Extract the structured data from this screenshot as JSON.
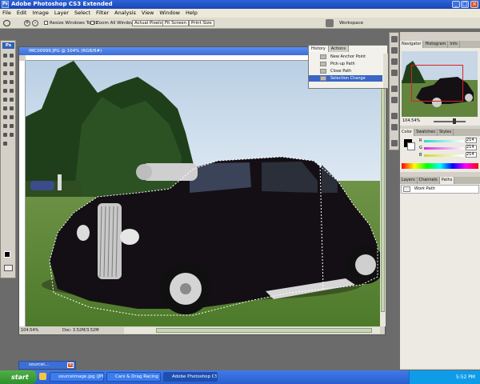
{
  "app": {
    "title": "Adobe Photoshop CS3 Extended",
    "icon_label": "Ps"
  },
  "menu": [
    "File",
    "Edit",
    "Image",
    "Layer",
    "Select",
    "Filter",
    "Analysis",
    "View",
    "Window",
    "Help"
  ],
  "options_bar": {
    "resize_windows_label": "Resize Windows To Fit",
    "zoom_all_label": "Zoom All Windows",
    "actual_pixels": "Actual Pixels",
    "fit_screen": "Fit Screen",
    "print_size": "Print Size",
    "workspace": "Workspace"
  },
  "toolbox": {
    "badge": "Ps"
  },
  "document": {
    "title": "IMC00999.JPG @ 104% (RGB/8#)",
    "zoom": "104.54%",
    "doc_info": "Doc: 3.52M/3.52M"
  },
  "history_panel": {
    "tabs": [
      "History",
      "Actions"
    ],
    "items": [
      "New Anchor Point",
      "Pick-up Path",
      "Close Path",
      "Selection Change"
    ],
    "selected_index": 3
  },
  "navigator_panel": {
    "tabs": [
      "Navigator",
      "Histogram",
      "Info"
    ],
    "zoom": "104.54%"
  },
  "color_panel": {
    "tabs": [
      "Color",
      "Swatches",
      "Styles"
    ],
    "channels": [
      {
        "label": "R",
        "value": "214"
      },
      {
        "label": "G",
        "value": "214"
      },
      {
        "label": "B",
        "value": "214"
      }
    ]
  },
  "paths_panel": {
    "tabs": [
      "Layers",
      "Channels",
      "Paths"
    ],
    "items": [
      "Work Path"
    ]
  },
  "minimized_doc": {
    "label": "sourcei..."
  },
  "taskbar": {
    "start": "start",
    "tasks": [
      "sourceimage.jpg (JPE...",
      "Cars & Drag Racing",
      "Adobe Photoshop CS..."
    ],
    "active_index": 2,
    "clock": "5:52 PM"
  },
  "colors": {
    "titlebar": "#1a46b8",
    "selection": "#3a66c4",
    "taskbar": "#2a5fd0",
    "start": "#2f8f2c"
  }
}
